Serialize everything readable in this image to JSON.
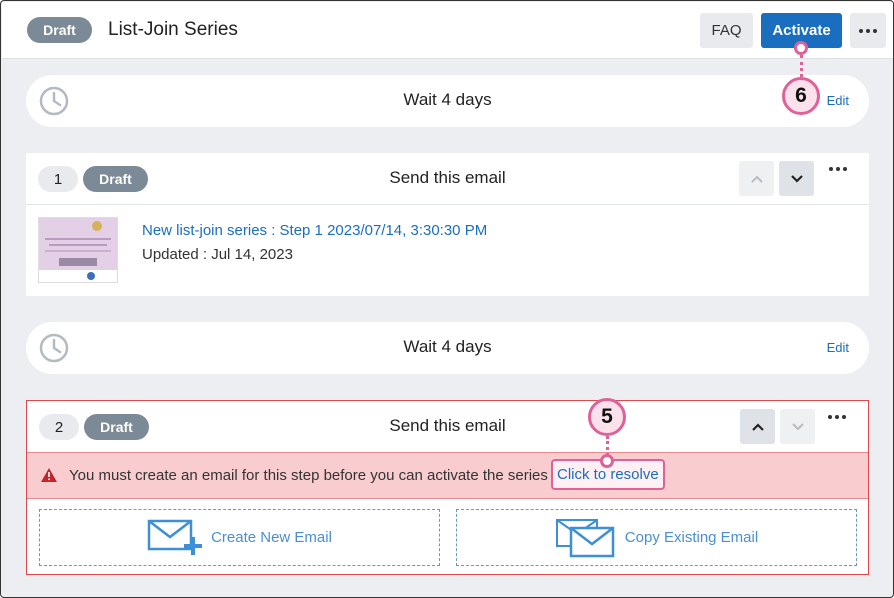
{
  "header": {
    "status_badge": "Draft",
    "title": "List-Join Series",
    "faq_label": "FAQ",
    "activate_label": "Activate"
  },
  "waits": [
    {
      "text": "Wait 4 days",
      "edit_label": "Edit"
    },
    {
      "text": "Wait 4 days",
      "edit_label": "Edit"
    }
  ],
  "steps": [
    {
      "number": "1",
      "status": "Draft",
      "title": "Send this email",
      "email_link": "New list-join series : Step 1 2023/07/14, 3:30:30 PM",
      "updated": "Updated : Jul 14, 2023"
    },
    {
      "number": "2",
      "status": "Draft",
      "title": "Send this email",
      "warning": "You must create an email for this step before you can activate the series",
      "resolve_label": "Click to resolve",
      "create_label": "Create New Email",
      "copy_label": "Copy Existing Email"
    }
  ],
  "callouts": {
    "activate": "6",
    "resolve": "5"
  },
  "colors": {
    "accent": "#1a6ec0",
    "badge": "#7b8a96",
    "warning_bg": "#f9cccf",
    "callout": "#e0609a"
  }
}
